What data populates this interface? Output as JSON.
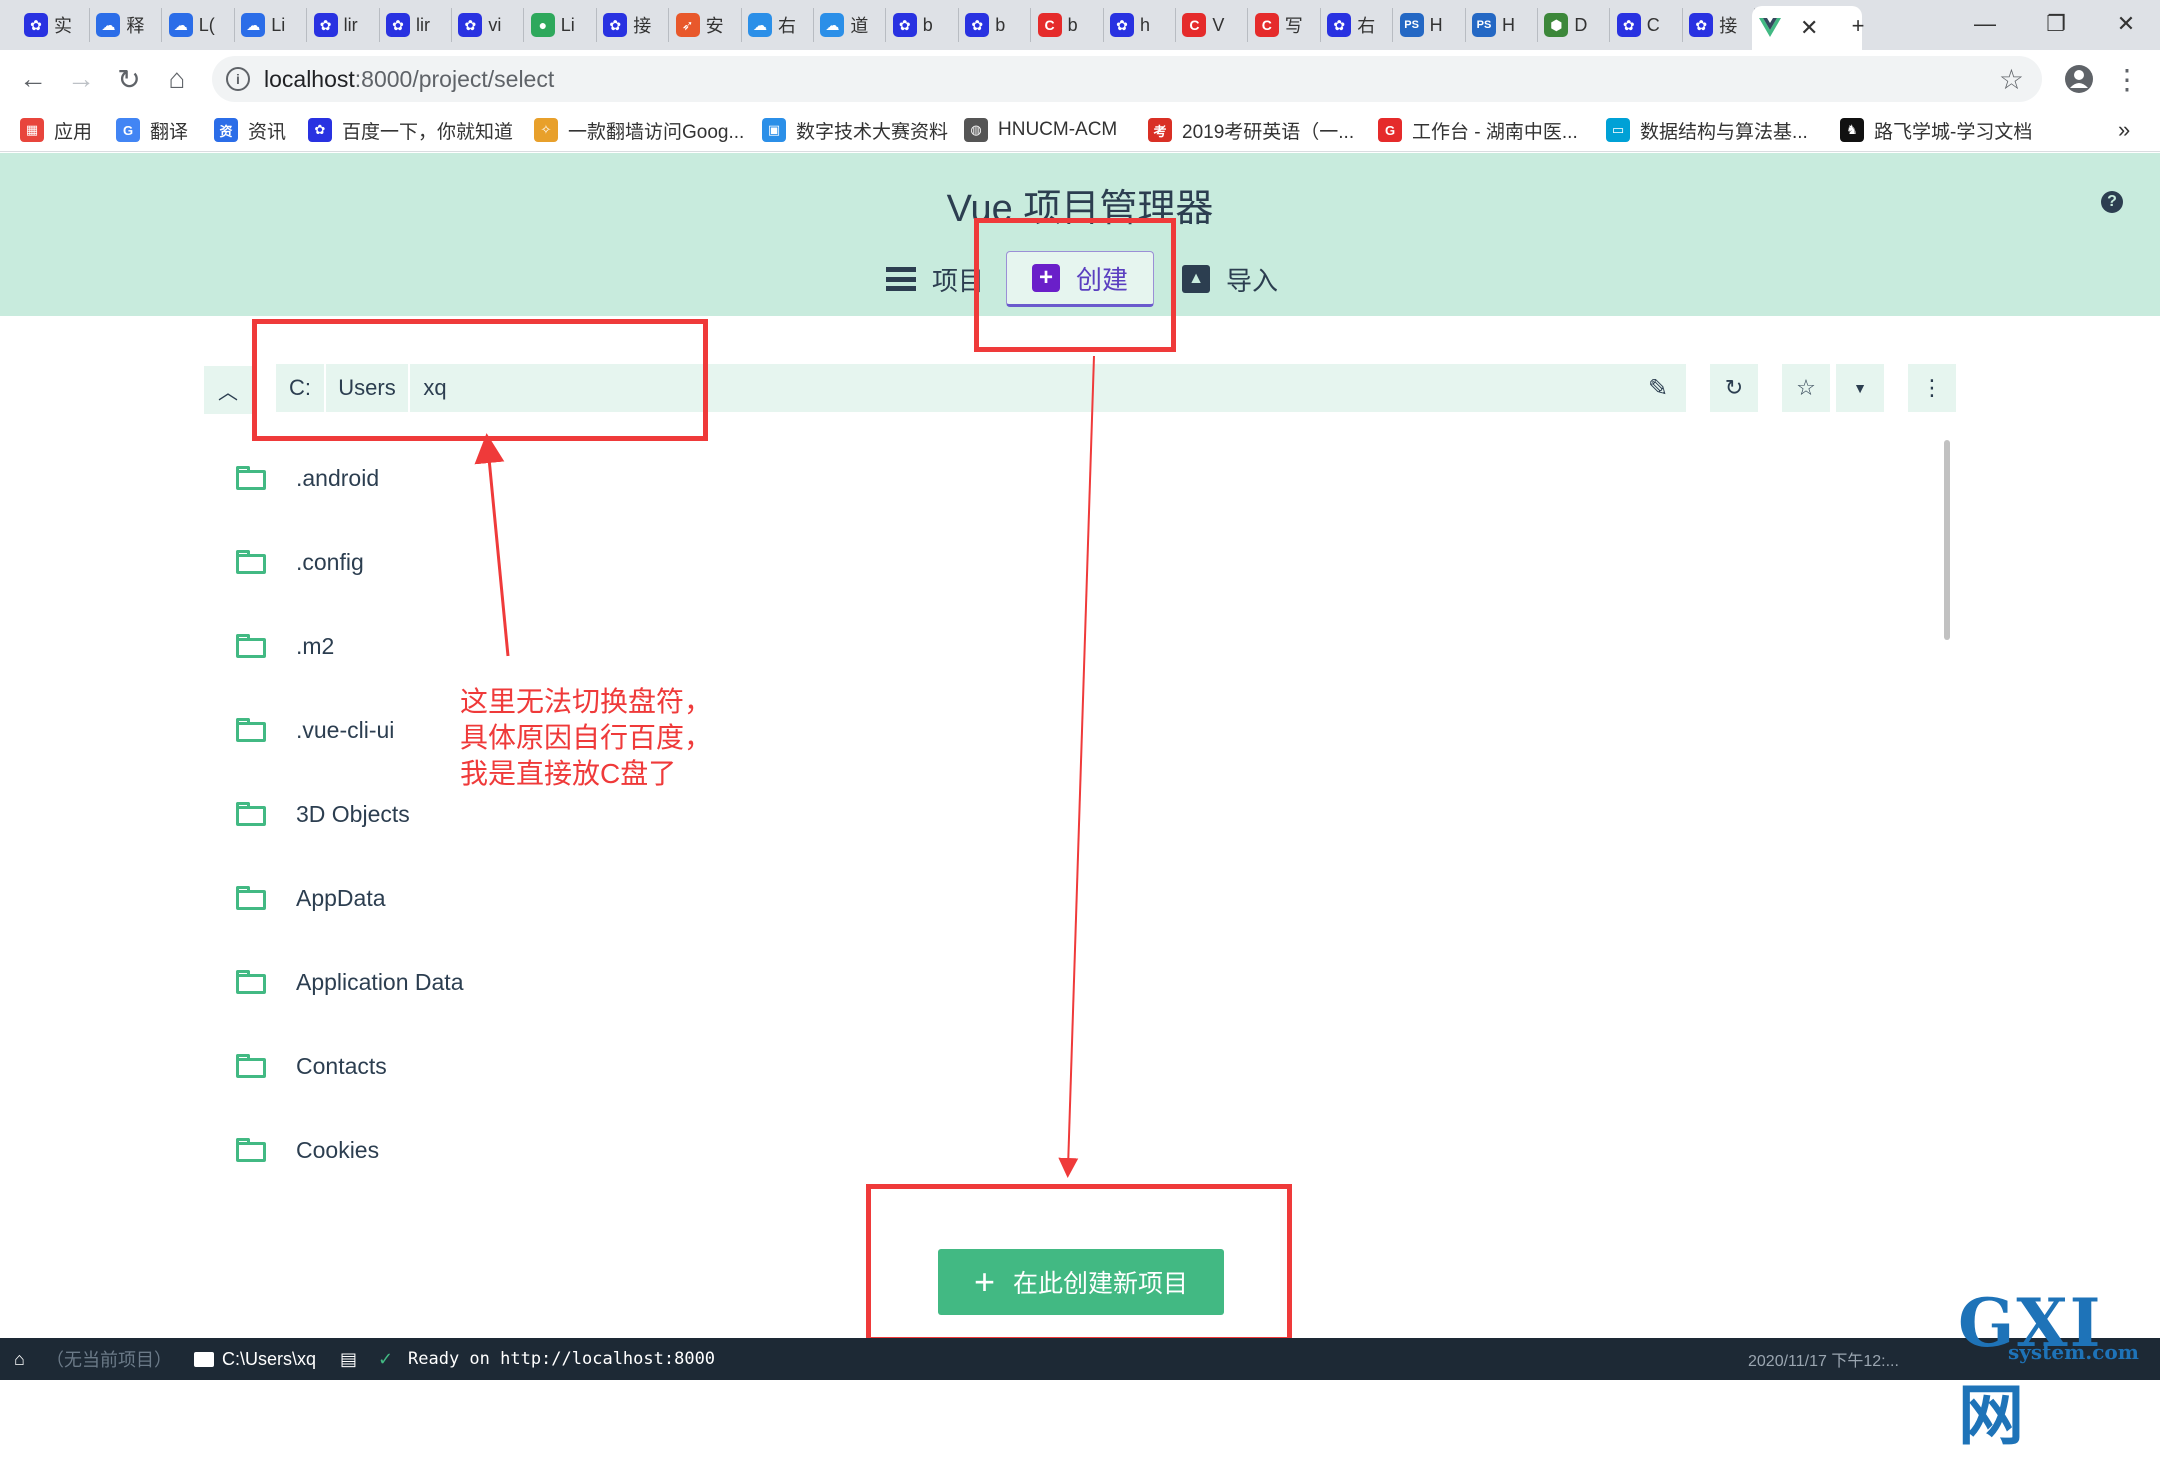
{
  "browser": {
    "tabs": [
      {
        "label": "实",
        "favicon": "baidu-paw-icon",
        "color": "#2932e1"
      },
      {
        "label": "释",
        "favicon": "cloud-icon",
        "color": "#2b6de8"
      },
      {
        "label": "L(",
        "favicon": "cloud-icon",
        "color": "#2b6de8"
      },
      {
        "label": "Li",
        "favicon": "cloud-icon",
        "color": "#2b6de8"
      },
      {
        "label": "lir",
        "favicon": "baidu-paw-icon",
        "color": "#2932e1"
      },
      {
        "label": "lir",
        "favicon": "baidu-paw-icon",
        "color": "#2932e1"
      },
      {
        "label": "vi",
        "favicon": "baidu-paw-icon",
        "color": "#2932e1"
      },
      {
        "label": "Li",
        "favicon": "green-circle-icon",
        "color": "#2ea85c"
      },
      {
        "label": "接",
        "favicon": "baidu-paw-icon",
        "color": "#2932e1"
      },
      {
        "label": "安",
        "favicon": "rocket-icon",
        "color": "#e8582b"
      },
      {
        "label": "右",
        "favicon": "cloud-outline-icon",
        "color": "#2b8fe8"
      },
      {
        "label": "道",
        "favicon": "cloud-outline-icon",
        "color": "#2b8fe8"
      },
      {
        "label": "b",
        "favicon": "baidu-paw-icon",
        "color": "#2932e1"
      },
      {
        "label": "b",
        "favicon": "baidu-paw-icon",
        "color": "#2932e1"
      },
      {
        "label": "b",
        "favicon": "csdn-c-icon",
        "color": "#e52b2b"
      },
      {
        "label": "h",
        "favicon": "baidu-paw-icon",
        "color": "#2932e1"
      },
      {
        "label": "V",
        "favicon": "csdn-c-icon",
        "color": "#e52b2b"
      },
      {
        "label": "写",
        "favicon": "csdn-c-icon",
        "color": "#e52b2b"
      },
      {
        "label": "右",
        "favicon": "baidu-paw-icon",
        "color": "#2932e1"
      },
      {
        "label": "H",
        "favicon": "ps-icon",
        "color": "#2468c4"
      },
      {
        "label": "H",
        "favicon": "ps-icon",
        "color": "#2468c4"
      },
      {
        "label": "D",
        "favicon": "nodejs-hex-icon",
        "color": "#3c873a"
      },
      {
        "label": "C",
        "favicon": "baidu-paw-icon",
        "color": "#2932e1"
      },
      {
        "label": "接",
        "favicon": "baidu-paw-icon",
        "color": "#2932e1"
      }
    ],
    "active_tab_favicon": "vue-logo-icon",
    "new_tab": "+",
    "url_host": "localhost",
    "url_path": ":8000/project/select",
    "bookmarks": [
      {
        "label": "应用",
        "icon": "apps-grid-icon",
        "color": "#e8453c"
      },
      {
        "label": "翻译",
        "icon": "translate-icon",
        "color": "#4285f4"
      },
      {
        "label": "资讯",
        "icon": "news-icon",
        "color": "#2b6de8"
      },
      {
        "label": "百度一下，你就知道",
        "icon": "baidu-paw-icon",
        "color": "#2932e1"
      },
      {
        "label": "一款翻墙访问Goog...",
        "icon": "wand-icon",
        "color": "#e8a02b"
      },
      {
        "label": "数字技术大赛资料",
        "icon": "doc-icon",
        "color": "#2b8fe8"
      },
      {
        "label": "HNUCM-ACM",
        "icon": "globe-icon",
        "color": "#555555"
      },
      {
        "label": "2019考研英语（一...",
        "icon": "kaoyan-icon",
        "color": "#d93025"
      },
      {
        "label": "工作台 - 湖南中医...",
        "icon": "g-icon",
        "color": "#e52b2b"
      },
      {
        "label": "数据结构与算法基...",
        "icon": "bilibili-icon",
        "color": "#00a1d6"
      },
      {
        "label": "路飞学城-学习文档",
        "icon": "luffy-icon",
        "color": "#111111"
      }
    ],
    "more_bookmarks": "»"
  },
  "app": {
    "title": "Vue 项目管理器",
    "help": "?",
    "tabs": {
      "projects": "项目",
      "create": "创建",
      "import": "导入"
    },
    "path_segments": [
      "C:",
      "Users",
      "xq"
    ],
    "folders": [
      ".android",
      ".config",
      ".m2",
      ".vue-cli-ui",
      "3D Objects",
      "AppData",
      "Application Data",
      "Contacts",
      "Cookies"
    ],
    "create_here_button": "在此创建新项目"
  },
  "annotation": {
    "lines": [
      "这里无法切换盘符，",
      "具体原因自行百度，",
      "我是直接放C盘了"
    ],
    "color": "#ef3a3a"
  },
  "statusbar": {
    "no_project": "（无当前项目）",
    "cwd": "C:\\Users\\xq",
    "log": "Ready on http://localhost:8000",
    "datetime": "2020/11/17  下午12:..."
  },
  "watermark": {
    "logo_text": "GXI网",
    "domain_text": "system.com"
  }
}
